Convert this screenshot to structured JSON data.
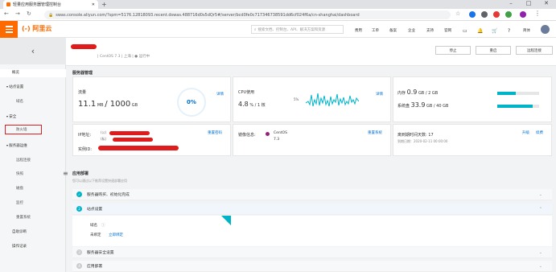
{
  "browser": {
    "tab_title": "轻量应用服务器管理控制台",
    "new_tab": "+",
    "url": "swas.console.aliyun.com/?spm=5176.12818093.recent.dswas.488716d0s5dQr5#/server/bcd0fe0c717346738591dd6cf024f6a/cn-shanghai/dashboard",
    "min": "–",
    "max": "□",
    "close": "✕"
  },
  "header": {
    "logo": "(-) 阿里云",
    "search_placeholder": "搜索文档、控制台、API、解决方案和资源",
    "nav": [
      "费用",
      "工单",
      "备案",
      "企业",
      "支持",
      "官网"
    ],
    "lang": "简体"
  },
  "sidebar": {
    "overview": "概览",
    "site_group": "站点设置",
    "domain": "域名",
    "security_group": "安全",
    "firewall": "防火墙",
    "ops_group": "服务器运维",
    "remote": "远程连接",
    "snapshot": "快照",
    "disk": "磁盘",
    "monitor": "监控",
    "reset": "重置系统",
    "auto_diag": "自助诊断",
    "op_log": "操作记录"
  },
  "title": {
    "sub": "| CentOS 7.3 | 上海 | ● 运行中",
    "stop": "停止",
    "restart": "重启",
    "remote": "远程连接"
  },
  "server": {
    "section": "服务器管理",
    "traffic_label": "流量",
    "traffic_used": "11.1",
    "traffic_unit_used": "MB",
    "traffic_total": "/ 1000",
    "traffic_unit": "GB",
    "traffic_pct": "0%",
    "details": "详情",
    "cpu_label": "CPU使用",
    "cpu_val": "4.8",
    "cpu_unit": "% / 1 核",
    "cpu_spark_label": "5%",
    "mem_label": "内存",
    "mem_val": "0.9",
    "mem_unit": "GB / 2 GB",
    "mem_fraction": 0.45,
    "disk_label": "系统盘",
    "disk_val": "33.9",
    "disk_unit": "GB / 40 GB",
    "disk_fraction": 0.85,
    "ip_label": "IP地址:",
    "ip_pub": "(公)",
    "ip_priv": "(私)",
    "reset_pwd": "重置密码",
    "instance_label": "实例ID:",
    "image_label": "镜像信息:",
    "image_name": "CentOS",
    "image_ver": "7.3",
    "reset_system": "重置系统",
    "expire_label": "离到期时间天数:",
    "expire_days": "17",
    "expire_date": "到期日期：2020-02-11 00:00:00",
    "upgrade": "升级",
    "renew": "续费"
  },
  "deploy": {
    "section": "应用部署",
    "hint": "您可以通过以下推荐设置快速部署应用",
    "step1": "服务器购买、初始化完成",
    "step2": "站点设置",
    "step2_no": "2",
    "domain_label": "域名",
    "unbound": "未绑定",
    "bind_now": "立即绑定",
    "step3": "服务器安全设置",
    "step3_no": "3",
    "step4": "应用部署",
    "step4_no": "4"
  },
  "colors": {
    "accent": "#ff6a00",
    "link": "#0070cc",
    "teal": "#00b4c8",
    "redact": "#e01b1b"
  }
}
